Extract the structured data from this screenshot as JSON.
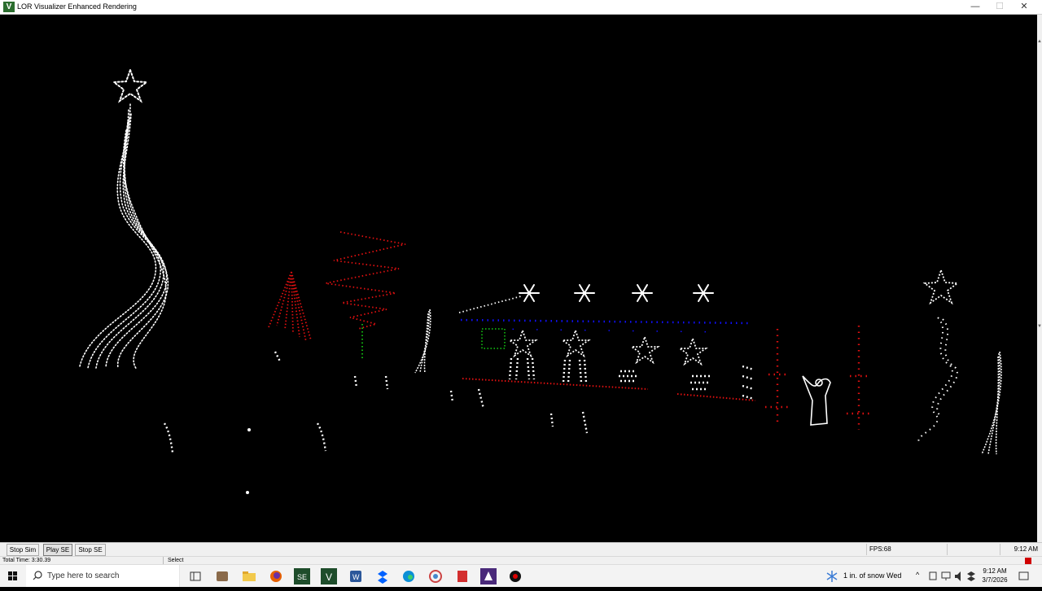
{
  "window": {
    "icon_letter": "V",
    "title": "LOR Visualizer Enhanced Rendering",
    "minimize": "—",
    "maximize": "☐",
    "close": "✕"
  },
  "toolbar": {
    "stop_sim": "Stop Sim",
    "play_se": "Play SE",
    "stop_se": "Stop SE",
    "fps": "FPS:68",
    "time": "9:12 AM"
  },
  "status": {
    "total_time": "Total Time: 3:30.39",
    "mode": "Select"
  },
  "taskbar": {
    "search_placeholder": "Type here to search",
    "weather": "1 in. of snow Wed",
    "clock_time": "9:12 AM",
    "clock_date": "3/7/2026",
    "pinned_icons": [
      "task-view-icon",
      "app-icon-1",
      "file-explorer-icon",
      "firefox-icon",
      "sequence-editor-icon",
      "visualizer-icon",
      "word-icon",
      "dropbox-icon",
      "edge-icon",
      "chrome-like-icon",
      "pdf-icon",
      "lor-app-icon",
      "lor-control-icon"
    ]
  },
  "colors": {
    "canvas_bg": "#000000",
    "light_white": "#ffffff",
    "light_red": "#e01010",
    "light_blue": "#1010ff",
    "light_green": "#10b010"
  }
}
